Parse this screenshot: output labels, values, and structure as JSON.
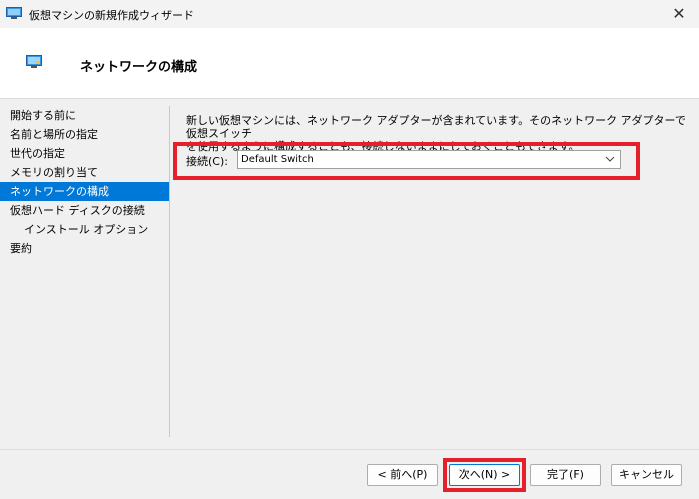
{
  "window": {
    "title": "仮想マシンの新規作成ウィザード",
    "close_symbol": "✕"
  },
  "header": {
    "title": "ネットワークの構成"
  },
  "nav": {
    "items": [
      {
        "label": "開始する前に"
      },
      {
        "label": "名前と場所の指定"
      },
      {
        "label": "世代の指定"
      },
      {
        "label": "メモリの割り当て"
      },
      {
        "label": "ネットワークの構成",
        "selected": true
      },
      {
        "label": "仮想ハード ディスクの接続"
      },
      {
        "label": "インストール オプション"
      },
      {
        "label": "要約"
      }
    ]
  },
  "main": {
    "description_line1": "新しい仮想マシンには、ネットワーク アダプターが含まれています。そのネットワーク アダプターで仮想スイッチ",
    "description_line2": "を使用するように構成することも、接続しないままにしておくこともできます。",
    "connection_label": "接続(C):",
    "connection_value": "Default Switch"
  },
  "buttons": {
    "prev": "< 前へ(P)",
    "next": "次へ(N) >",
    "finish": "完了(F)",
    "cancel": "キャンセル"
  },
  "colors": {
    "highlight": "#e5202b",
    "selection": "#0078d7"
  },
  "icons": [
    "hyperv-app-icon",
    "close-icon",
    "vm-network-icon",
    "chevron-down-icon"
  ]
}
